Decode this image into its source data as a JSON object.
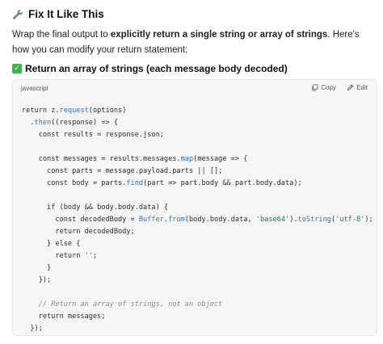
{
  "heading": {
    "icon": "wrench-icon",
    "text": "Fix It Like This"
  },
  "intro": {
    "before": "Wrap the final output to ",
    "bold": "explicitly return a single string or array of strings",
    "after": ". Here's how you can modify your return statement:"
  },
  "subheading": {
    "icon": "check-mark-icon",
    "text": "Return an array of strings (each message body decoded)"
  },
  "codeblock": {
    "language": "javascript",
    "copy_label": "Copy",
    "edit_label": "Edit",
    "lines": [
      [
        {
          "t": "return z."
        },
        {
          "t": "request",
          "c": "fn"
        },
        {
          "t": "(options)"
        }
      ],
      [
        {
          "t": "  ."
        },
        {
          "t": "then",
          "c": "fn"
        },
        {
          "t": "((response) => {"
        }
      ],
      [
        {
          "t": "    const results = response.json;"
        }
      ],
      [
        {
          "t": ""
        }
      ],
      [
        {
          "t": "    const messages = results.messages."
        },
        {
          "t": "map",
          "c": "fn"
        },
        {
          "t": "(message => {"
        }
      ],
      [
        {
          "t": "      const parts = message.payload.parts || [];"
        }
      ],
      [
        {
          "t": "      const body = parts."
        },
        {
          "t": "find",
          "c": "fn"
        },
        {
          "t": "(part => part.body && part.body.data);"
        }
      ],
      [
        {
          "t": ""
        }
      ],
      [
        {
          "t": "      if (body && body.body.data) {"
        }
      ],
      [
        {
          "t": "        const decodedBody = "
        },
        {
          "t": "Buffer",
          "c": "fn"
        },
        {
          "t": "."
        },
        {
          "t": "from",
          "c": "fn"
        },
        {
          "t": "(body.body.data, "
        },
        {
          "t": "'base64'",
          "c": "str"
        },
        {
          "t": ")."
        },
        {
          "t": "toString",
          "c": "fn"
        },
        {
          "t": "("
        },
        {
          "t": "'utf-8'",
          "c": "str"
        },
        {
          "t": ");"
        }
      ],
      [
        {
          "t": "        return decodedBody;"
        }
      ],
      [
        {
          "t": "      } else {"
        }
      ],
      [
        {
          "t": "        return "
        },
        {
          "t": "''",
          "c": "str"
        },
        {
          "t": ";"
        }
      ],
      [
        {
          "t": "      }"
        }
      ],
      [
        {
          "t": "    });"
        }
      ],
      [
        {
          "t": ""
        }
      ],
      [
        {
          "t": "    // Return an array of strings, not an object",
          "c": "cm"
        }
      ],
      [
        {
          "t": "    return messages;"
        }
      ],
      [
        {
          "t": "  });"
        }
      ]
    ]
  }
}
